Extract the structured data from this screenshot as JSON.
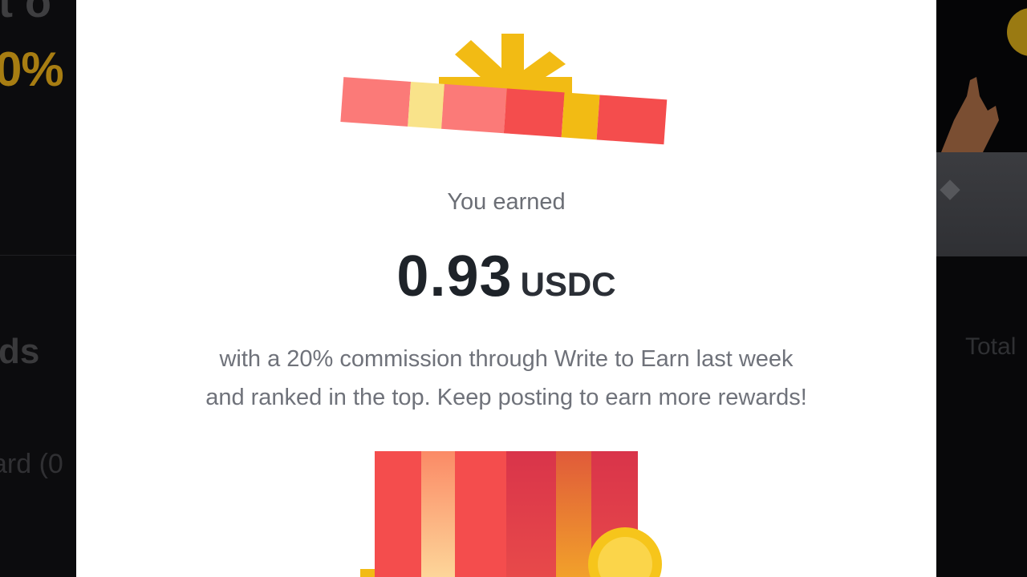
{
  "background": {
    "left": {
      "partial_heading": "t o",
      "partial_percent": "0%",
      "partial_title": "ds",
      "partial_label": "ard (0"
    },
    "right": {
      "partial_total": "Total"
    }
  },
  "modal": {
    "earned_label": "You earned",
    "amount": "0.93",
    "currency": "USDC",
    "description_line1": "with a 20% commission through Write to Earn last week",
    "description_line2": "and ranked in the top. Keep posting to earn more rewards!"
  },
  "colors": {
    "gift_red": "#f44d4d",
    "gift_pink": "#fb7a78",
    "gift_yellow": "#f2bb14",
    "gift_pale_yellow": "#f9e38a",
    "coin_gold": "#f6c51b",
    "text_dark": "#1e2329",
    "text_muted": "#6f727a"
  },
  "icons": [
    "gift-lid-icon",
    "gift-box-icon",
    "gold-coin-icon",
    "hand-icon"
  ]
}
